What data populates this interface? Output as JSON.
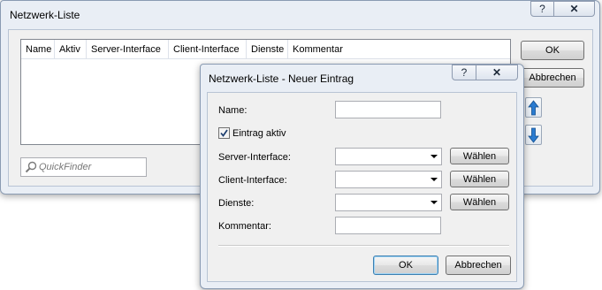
{
  "main_window": {
    "title": "Netzwerk-Liste",
    "help_glyph": "?",
    "close_glyph": "✕",
    "columns": [
      "Name",
      "Aktiv",
      "Server-Interface",
      "Client-Interface",
      "Dienste",
      "Kommentar"
    ],
    "quickfinder_placeholder": "QuickFinder",
    "ok_label": "OK",
    "cancel_label": "Abbrechen"
  },
  "dialog": {
    "title": "Netzwerk-Liste - Neuer Eintrag",
    "help_glyph": "?",
    "close_glyph": "✕",
    "name_label": "Name:",
    "name_value": "",
    "active_label": "Eintrag aktiv",
    "active_checked": true,
    "server_interface_label": "Server-Interface:",
    "client_interface_label": "Client-Interface:",
    "services_label": "Dienste:",
    "comment_label": "Kommentar:",
    "choose_label": "Wählen",
    "ok_label": "OK",
    "cancel_label": "Abbrechen"
  },
  "icons": {
    "search": "magnifier-icon",
    "up": "arrow-up-icon",
    "down": "arrow-down-icon"
  },
  "colors": {
    "arrow_blue": "#2a7bd0",
    "window_frame": "#e9eef5"
  }
}
